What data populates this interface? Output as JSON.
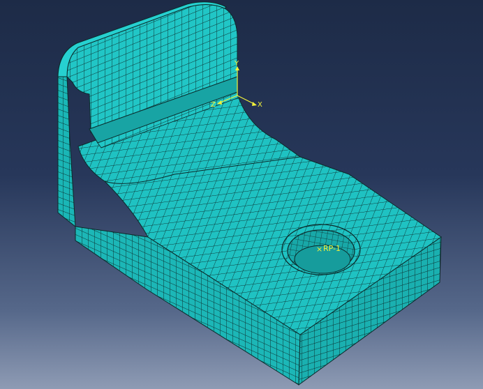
{
  "viewport": {
    "background_top": "#1d2b47",
    "background_bottom": "#8e9bb4"
  },
  "model": {
    "mesh_color": "#1fc2c2",
    "mesh_line_color": "#0b2a2a"
  },
  "triad": {
    "color": "#f2f23a",
    "x_label": "X",
    "y_label": "Y",
    "z_label": "Z"
  },
  "reference_point": {
    "label": "RP-1",
    "marker": "×"
  }
}
